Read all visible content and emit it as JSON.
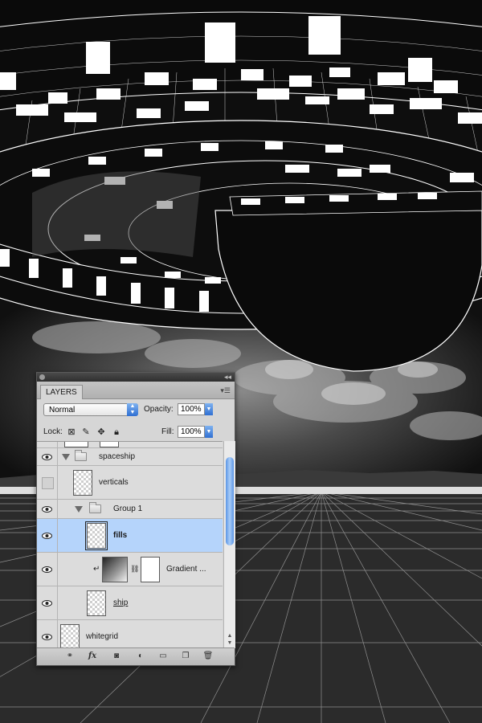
{
  "canvas": {
    "sky_color": "#0e0e0e",
    "ship_color": "#0a0a0a",
    "line_color": "#ffffff"
  },
  "panel": {
    "tab_label": "LAYERS",
    "blend_mode": "Normal",
    "opacity_label": "Opacity:",
    "opacity_value": "100%",
    "lock_label": "Lock:",
    "fill_label": "Fill:",
    "fill_value": "100%",
    "selected_color": "#b5d4fb"
  },
  "layers": [
    {
      "name": "spaceship",
      "kind": "group",
      "visible": true
    },
    {
      "name": "verticals",
      "kind": "layer",
      "visible": false
    },
    {
      "name": "Group 1",
      "kind": "group",
      "visible": true
    },
    {
      "name": "fills",
      "kind": "layer",
      "visible": true,
      "selected": true
    },
    {
      "name": "Gradient ...",
      "kind": "adjustment",
      "visible": true
    },
    {
      "name": "ship",
      "kind": "layer",
      "visible": true
    },
    {
      "name": "whitegrid",
      "kind": "layer",
      "visible": true
    }
  ],
  "icons": {
    "link": "link-icon",
    "fx": "fx-icon",
    "mask": "add-mask-icon",
    "adjustment": "adjustment-layer-icon",
    "folder": "new-group-icon",
    "new_layer": "new-layer-icon",
    "trash": "trash-icon",
    "fx_label": "fx"
  }
}
